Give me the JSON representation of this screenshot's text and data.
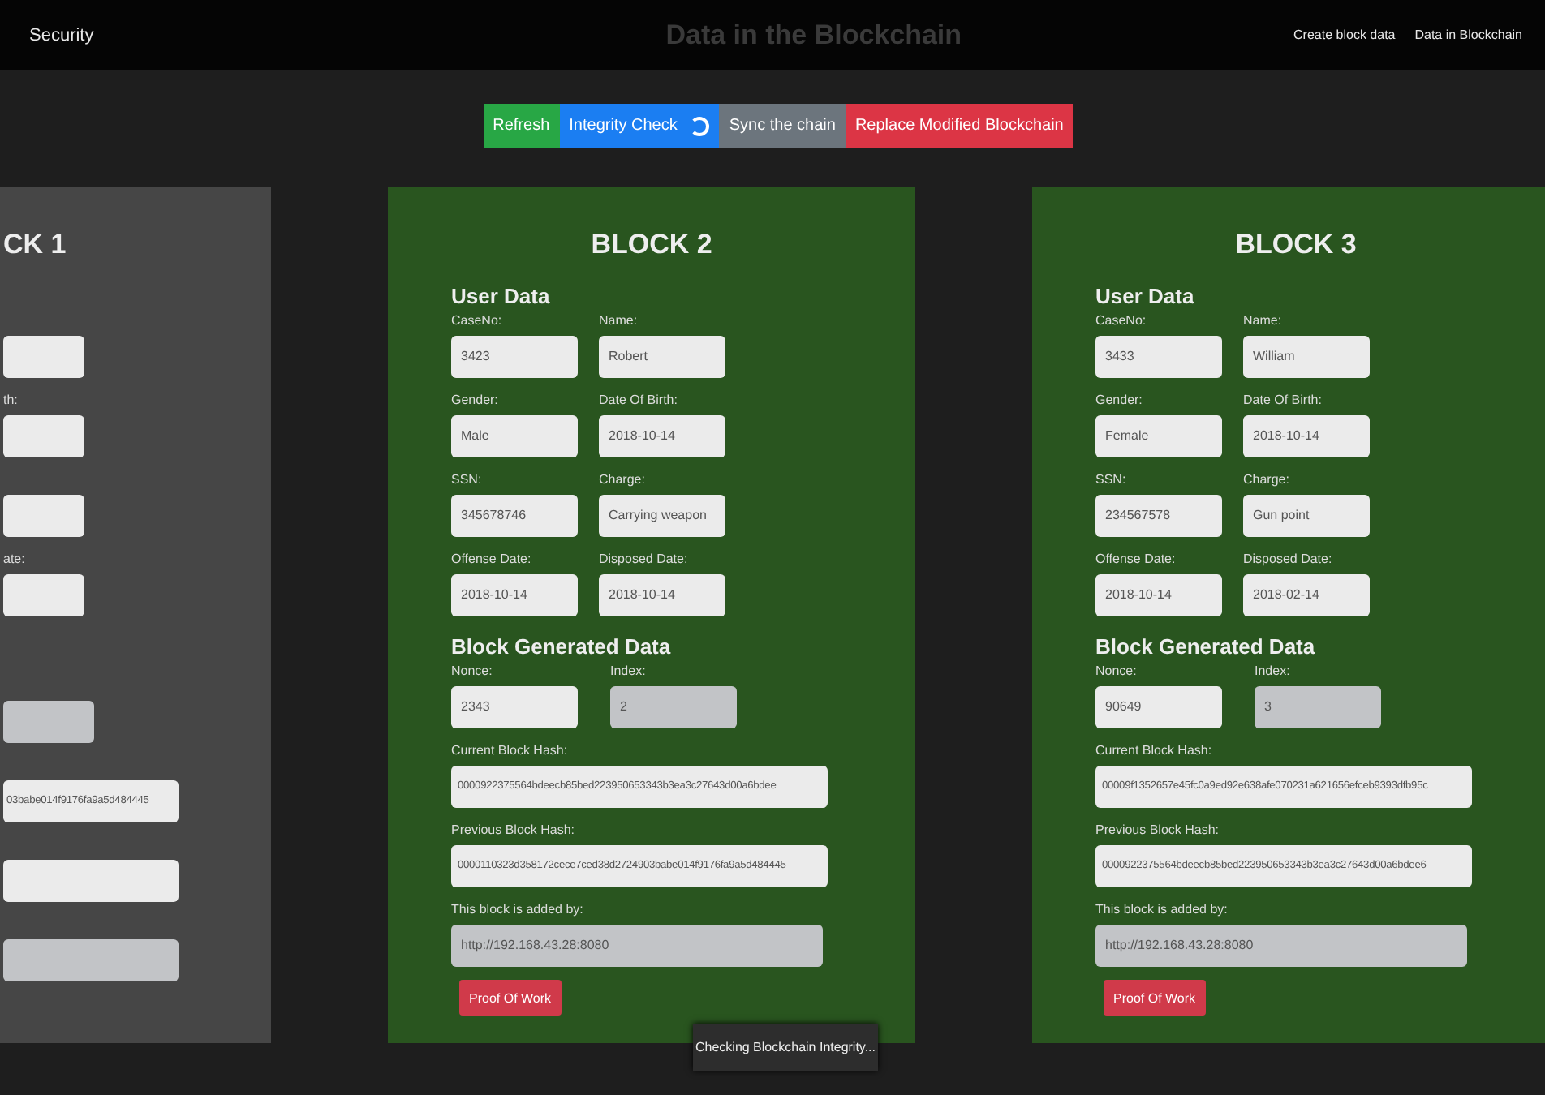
{
  "navbar": {
    "brand": "Security",
    "title": "Data in the Blockchain",
    "links": [
      "Create block data",
      "Data in Blockchain"
    ]
  },
  "actions": [
    {
      "label": "Refresh",
      "kind": "success",
      "busy": false
    },
    {
      "label": "Integrity Check",
      "kind": "primary",
      "busy": true
    },
    {
      "label": "Sync the chain",
      "kind": "secondary",
      "busy": false
    },
    {
      "label": "Replace Modified Blockchain",
      "kind": "danger",
      "busy": false
    }
  ],
  "partial_block": {
    "title": "CK 1",
    "color": "#464646",
    "sections": [
      {
        "fields": [
          {
            "kind": "half",
            "readonly": false
          },
          {
            "kind": "half",
            "readonly": false,
            "label": "th:"
          },
          {
            "kind": "half",
            "readonly": false
          },
          {
            "kind": "half",
            "readonly": false,
            "label": "ate:"
          }
        ]
      },
      {
        "fields": [
          {
            "kind": "index",
            "readonly": true
          },
          {
            "kind": "wide",
            "readonly": false,
            "value": "03babe014f9176fa9a5d484445"
          },
          {
            "kind": "wide",
            "readonly": false
          },
          {
            "kind": "wide",
            "readonly": true
          }
        ]
      }
    ]
  },
  "blocks": [
    {
      "title": "BLOCK 2",
      "color": "#29551f",
      "user_heading": "User Data",
      "generated_heading": "Block Generated Data",
      "button": "Proof Of Work",
      "user_fields": [
        {
          "label": "CaseNo:",
          "value": "3423"
        },
        {
          "label": "Name:",
          "value": "Robert"
        },
        {
          "label": "Gender:",
          "value": "Male"
        },
        {
          "label": "Date Of Birth:",
          "value": "2018-10-14"
        },
        {
          "label": "SSN:",
          "value": "345678746"
        },
        {
          "label": "Charge:",
          "value": "Carrying weapon"
        },
        {
          "label": "Offense Date:",
          "value": "2018-10-14"
        },
        {
          "label": "Disposed Date:",
          "value": "2018-10-14"
        }
      ],
      "generated_fields": [
        {
          "label": "Nonce:",
          "value": "2343",
          "kind": "half",
          "readonly": false
        },
        {
          "label": "Index:",
          "value": "2",
          "kind": "half",
          "readonly": true
        },
        {
          "label": "Current Block Hash:",
          "value": "0000922375564bdeecb85bed223950653343b3ea3c27643d00a6bdee",
          "kind": "wide",
          "readonly": false
        },
        {
          "label": "Previous Block Hash:",
          "value": "0000110323d358172cece7ced38d2724903babe014f9176fa9a5d484445",
          "kind": "wide",
          "readonly": false
        },
        {
          "label": "This block is added by:",
          "value": "http://192.168.43.28:8080",
          "kind": "wide",
          "readonly": true
        }
      ]
    },
    {
      "title": "BLOCK 3",
      "color": "#29551f",
      "user_heading": "User Data",
      "generated_heading": "Block Generated Data",
      "button": "Proof Of Work",
      "user_fields": [
        {
          "label": "CaseNo:",
          "value": "3433"
        },
        {
          "label": "Name:",
          "value": "William"
        },
        {
          "label": "Gender:",
          "value": "Female"
        },
        {
          "label": "Date Of Birth:",
          "value": "2018-10-14"
        },
        {
          "label": "SSN:",
          "value": "234567578"
        },
        {
          "label": "Charge:",
          "value": "Gun point"
        },
        {
          "label": "Offense Date:",
          "value": "2018-10-14"
        },
        {
          "label": "Disposed Date:",
          "value": "2018-02-14"
        }
      ],
      "generated_fields": [
        {
          "label": "Nonce:",
          "value": "90649",
          "kind": "half",
          "readonly": false
        },
        {
          "label": "Index:",
          "value": "3",
          "kind": "half",
          "readonly": true
        },
        {
          "label": "Current Block Hash:",
          "value": "00009f1352657e45fc0a9ed92e638afe070231a621656efceb9393dfb95c",
          "kind": "wide",
          "readonly": false
        },
        {
          "label": "Previous Block Hash:",
          "value": "0000922375564bdeecb85bed223950653343b3ea3c27643d00a6bdee6",
          "kind": "wide",
          "readonly": false
        },
        {
          "label": "This block is added by:",
          "value": "http://192.168.43.28:8080",
          "kind": "wide",
          "readonly": true
        }
      ]
    }
  ],
  "toast": "Checking Blockchain Integrity..."
}
